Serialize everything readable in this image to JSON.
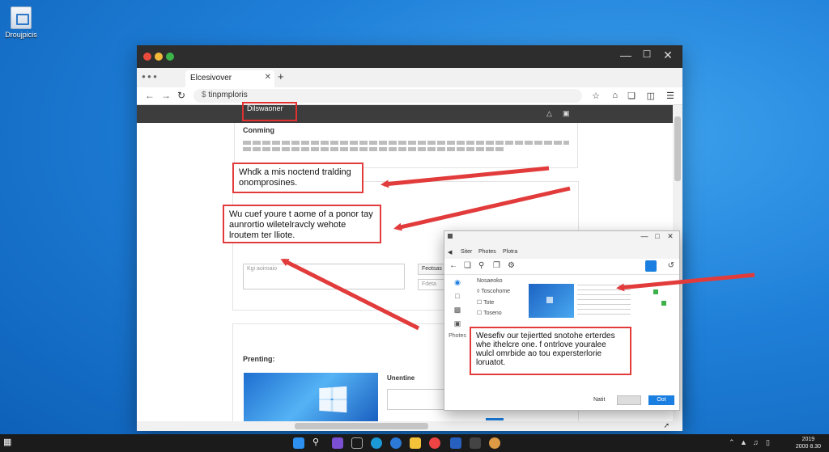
{
  "desktop": {
    "icon_label": "Droujpicis"
  },
  "browser": {
    "tab_title": "Elcesivover",
    "address": "tinpmploris",
    "site_brand": "Dilswaoner",
    "section_heading": "Conming",
    "callout1": "Whdk a mis noctend tralding onomprosines.",
    "callout2": "Wu cuef youre t aome of a ponor tay aunrortio wiletelravcly wehote lroutem ter lliote.",
    "input_placeholder": "Kgi aoiroaio",
    "side_button": "Feotsas",
    "side_field": "Fdeta",
    "section2_heading": "Prenting:",
    "section2_label": "Unentine"
  },
  "photos_app": {
    "tabs": [
      "Siter",
      "Photes",
      "Plotra"
    ],
    "sidebar_label": "Photes",
    "list": [
      "Nosaeoko",
      "Toscohome",
      "Tote",
      "Toseno"
    ],
    "callout": "Wesefiv our tejiertted snotohe erterdes whe ithelcre one. f ontrlove youralee wulcl omrbide ao tou expersterlorie loruatot.",
    "btn_secondary": "Natit",
    "btn_primary": "Oot"
  },
  "taskbar": {
    "time": "2019",
    "date": "2000 8.30"
  },
  "colors": {
    "accent": "#e23b3b",
    "taskbar": "#1b1b1b",
    "primary_button": "#1a7fe0"
  }
}
